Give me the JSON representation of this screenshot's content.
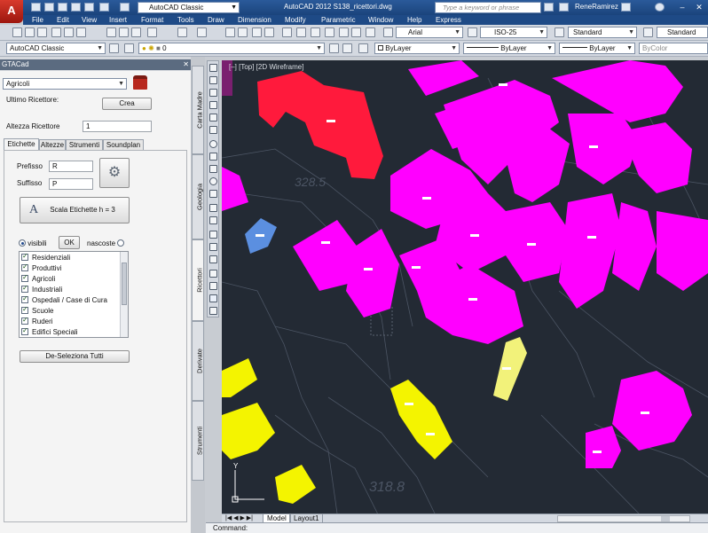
{
  "titlebar": {
    "workspace": "AutoCAD Classic",
    "title": "AutoCAD 2012   S138_ricettori.dwg",
    "search_placeholder": "Type a keyword or phrase",
    "user": "ReneRamirez"
  },
  "menu": [
    "File",
    "Edit",
    "View",
    "Insert",
    "Format",
    "Tools",
    "Draw",
    "Dimension",
    "Modify",
    "Parametric",
    "Window",
    "Help",
    "Express"
  ],
  "toolbar": {
    "font": "Arial",
    "dim_style": "ISO-25",
    "table_style": "Standard",
    "multileader_style": "Standard",
    "workspace": "AutoCAD Classic",
    "layer": "0",
    "color": "ByLayer",
    "linetype": "ByLayer",
    "lineweight": "ByLayer",
    "plotstyle": "ByColor"
  },
  "palette": {
    "title": "GTACad",
    "category": "Agricoli",
    "ultimo_label": "Ultimo Ricettore:",
    "crea_button": "Crea",
    "altezza_label": "Altezza Ricettore",
    "altezza_value": "1",
    "tabs": [
      "Etichette",
      "Altezze",
      "Strumenti",
      "Soundplan"
    ],
    "prefisso_label": "Prefisso",
    "prefisso_value": "R",
    "suffisso_label": "Suffisso",
    "suffisso_value": "P",
    "scala_button": "Scala Etichette h = 3",
    "visibili_label": "visibili",
    "ok_button": "OK",
    "nascoste_label": "nascoste",
    "list_items": [
      "Residenziali",
      "Produttivi",
      "Agricoli",
      "Industriali",
      "Ospedali / Case di Cura",
      "Scuole",
      "Ruderi",
      "Edifici Speciali"
    ],
    "deselect_button": "De-Seleziona Tutti",
    "side_tabs": [
      "Carta Madre",
      "Geologia",
      "Ricettori",
      "Derivate",
      "Strumenti"
    ]
  },
  "viewport": {
    "label": "[–] [Top] [2D Wireframe]",
    "layout_tabs": [
      "Model",
      "Layout1"
    ],
    "command_label": "Command:",
    "map_numbers": [
      "328.5",
      "318.8"
    ]
  },
  "colors": {
    "magenta": "#ff00ff",
    "red": "#ff1a3c",
    "yellow": "#f4f400",
    "pale_yellow": "#f2f27a",
    "blue": "#5b8fe0",
    "background": "#232a34"
  }
}
